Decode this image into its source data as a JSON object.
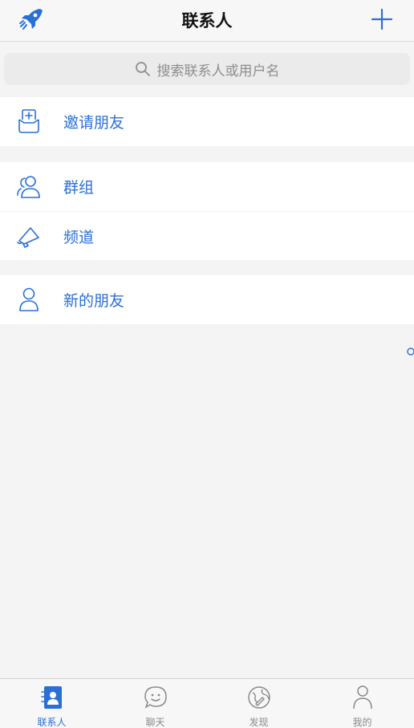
{
  "header": {
    "title": "联系人"
  },
  "search": {
    "placeholder": "搜索联系人或用户名"
  },
  "sections": {
    "invite": {
      "label": "邀请朋友"
    },
    "groups": {
      "label": "群组"
    },
    "channels": {
      "label": "频道"
    },
    "new_friends": {
      "label": "新的朋友"
    }
  },
  "tabbar": {
    "items": [
      {
        "label": "联系人",
        "icon": "contacts-icon",
        "active": true
      },
      {
        "label": "聊天",
        "icon": "chat-icon"
      },
      {
        "label": "发现",
        "icon": "discover-icon"
      },
      {
        "label": "我的",
        "icon": "profile-icon"
      }
    ]
  },
  "colors": {
    "accent": "#2b6fd6",
    "inactive": "#8a8a8a",
    "background": "#f4f4f4"
  }
}
